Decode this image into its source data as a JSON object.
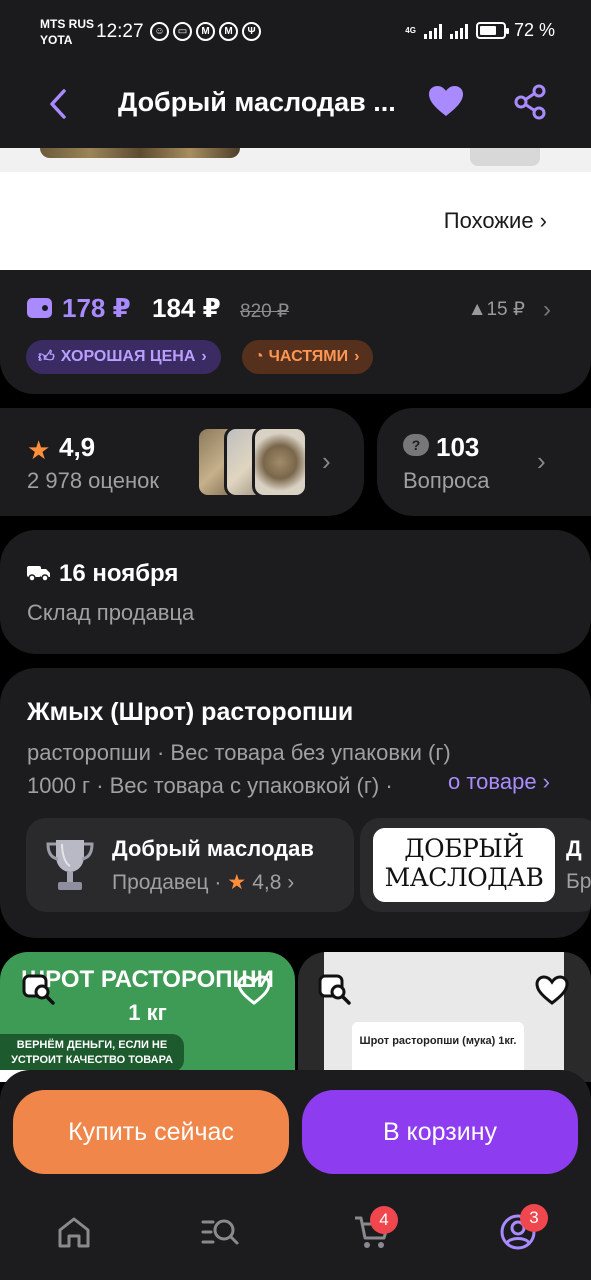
{
  "status_bar": {
    "carrier_line1": "MTS RUS",
    "carrier_line2": "YOTA",
    "time": "12:27",
    "network": "4G",
    "battery": "72 %",
    "battery_level": 0.72
  },
  "header": {
    "title": "Добрый маслодав ...",
    "back_icon": "chevron-left-icon",
    "favorite_icon": "heart-icon",
    "share_icon": "share-icon",
    "accent": "#a98bff"
  },
  "gallery": {
    "similar_link": "Похожие ›"
  },
  "price": {
    "card_price": "178 ₽",
    "price": "184 ₽",
    "old_price": "820 ₽",
    "diff": "▲15 ₽",
    "badge_good": "ХОРОШАЯ ЦЕНА",
    "badge_installments": "ЧАСТЯМИ"
  },
  "rating": {
    "value": "4,9",
    "count": "2 978 оценок"
  },
  "questions": {
    "count": "103",
    "label": "Вопроса"
  },
  "delivery": {
    "date": "16 ноября",
    "source": "Склад продавца"
  },
  "product": {
    "name": "Жмых (Шрот) расторопши",
    "desc_line1": "расторопши · Вес товара без упаковки (г)",
    "desc_line2": "1000 г · Вес товара с упаковкой (г) ·",
    "about_link": "о товаре ›"
  },
  "seller": {
    "name": "Добрый маслодав",
    "role": "Продавец ·",
    "rating": "4,8 ›"
  },
  "brand": {
    "logo_text_line1": "ДОБРЫЙ",
    "logo_text_line2": "МАСЛОДАВ",
    "name_cut": "Д",
    "sub_cut": "Бр"
  },
  "recommendations": [
    {
      "title": "ШРОТ РАСТОРОПШИ",
      "subtitle": "1 кг",
      "banner": "ВЕРНЁМ ДЕНЬГИ, ЕСЛИ НЕ УСТРОИТ КАЧЕСТВО ТОВАРА"
    },
    {
      "label": "Шрот расторопши (мука) 1кг."
    }
  ],
  "actions": {
    "buy_now": "Купить сейчас",
    "add_to_cart": "В корзину",
    "buy_color": "#f0864a",
    "cart_color": "#8e3cf0"
  },
  "bottom_nav": {
    "home_icon": "home-icon",
    "catalog_icon": "catalog-search-icon",
    "cart_icon": "cart-icon",
    "cart_badge": "4",
    "profile_icon": "profile-icon",
    "profile_badge": "3"
  }
}
